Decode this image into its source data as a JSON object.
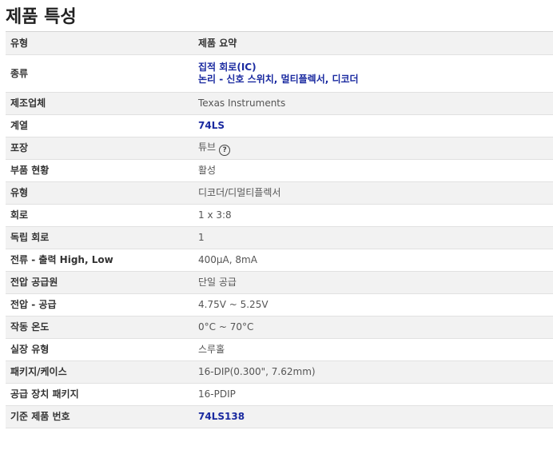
{
  "page_title": "제품 특성",
  "header": {
    "col1": "유형",
    "col2": "제품 요약"
  },
  "rows": [
    {
      "label": "종류",
      "values": [
        "집적 회로(IC)",
        "논리 - 신호 스위치, 멀티플렉서, 디코더"
      ]
    },
    {
      "label": "제조업체",
      "value": "Texas Instruments"
    },
    {
      "label": "계열",
      "value": "74LS"
    },
    {
      "label": "포장",
      "value": "튜브",
      "help_icon": "question-circle-icon"
    },
    {
      "label": "부품 현황",
      "value": "활성"
    },
    {
      "label": "유형",
      "value": "디코더/디멀티플렉서"
    },
    {
      "label": "회로",
      "value": "1 x 3:8"
    },
    {
      "label": "독립 회로",
      "value": "1"
    },
    {
      "label": "전류 - 출력 High, Low",
      "value": "400µA, 8mA"
    },
    {
      "label": "전압 공급원",
      "value": "단일 공급"
    },
    {
      "label": "전압 - 공급",
      "value": "4.75V ~ 5.25V"
    },
    {
      "label": "작동 온도",
      "value": "0°C ~ 70°C"
    },
    {
      "label": "실장 유형",
      "value": "스루홀"
    },
    {
      "label": "패키지/케이스",
      "value": "16-DIP(0.300\", 7.62mm)"
    },
    {
      "label": "공급 장치 패키지",
      "value": "16-PDIP"
    },
    {
      "label": "기준 제품 번호",
      "value": "74LS138"
    }
  ],
  "colors": {
    "link": "#1a2aa0",
    "alt_row": "#f2f2f2"
  }
}
